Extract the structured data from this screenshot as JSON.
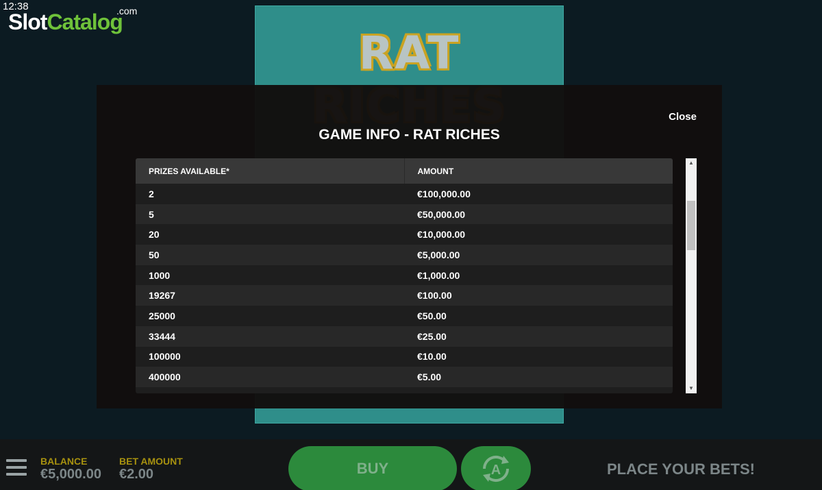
{
  "status": {
    "clock": "12:38"
  },
  "watermark": {
    "slot": "Slot",
    "catalog": "Catalog",
    "dotcom": ".com"
  },
  "game": {
    "title": "RAT RICHES"
  },
  "modal": {
    "close_label": "Close",
    "title": "GAME INFO - RAT RICHES",
    "columns": [
      "PRIZES AVAILABLE*",
      "AMOUNT"
    ],
    "rows": [
      {
        "prizes": "2",
        "amount": "€100,000.00"
      },
      {
        "prizes": "5",
        "amount": "€50,000.00"
      },
      {
        "prizes": "20",
        "amount": "€10,000.00"
      },
      {
        "prizes": "50",
        "amount": "€5,000.00"
      },
      {
        "prizes": "1000",
        "amount": "€1,000.00"
      },
      {
        "prizes": "19267",
        "amount": "€100.00"
      },
      {
        "prizes": "25000",
        "amount": "€50.00"
      },
      {
        "prizes": "33444",
        "amount": "€25.00"
      },
      {
        "prizes": "100000",
        "amount": "€10.00"
      },
      {
        "prizes": "400000",
        "amount": "€5.00"
      },
      {
        "prizes": "",
        "amount": ""
      }
    ]
  },
  "bottom_bar": {
    "balance_label": "BALANCE",
    "balance_value": "€5,000.00",
    "bet_label": "BET AMOUNT",
    "bet_value": "€2.00",
    "buy_label": "BUY",
    "status_text": "PLACE YOUR BETS!"
  },
  "colors": {
    "accent_green": "#2c8a3c",
    "label_yellow": "#a7910f",
    "logo_green": "#6fc23a"
  }
}
